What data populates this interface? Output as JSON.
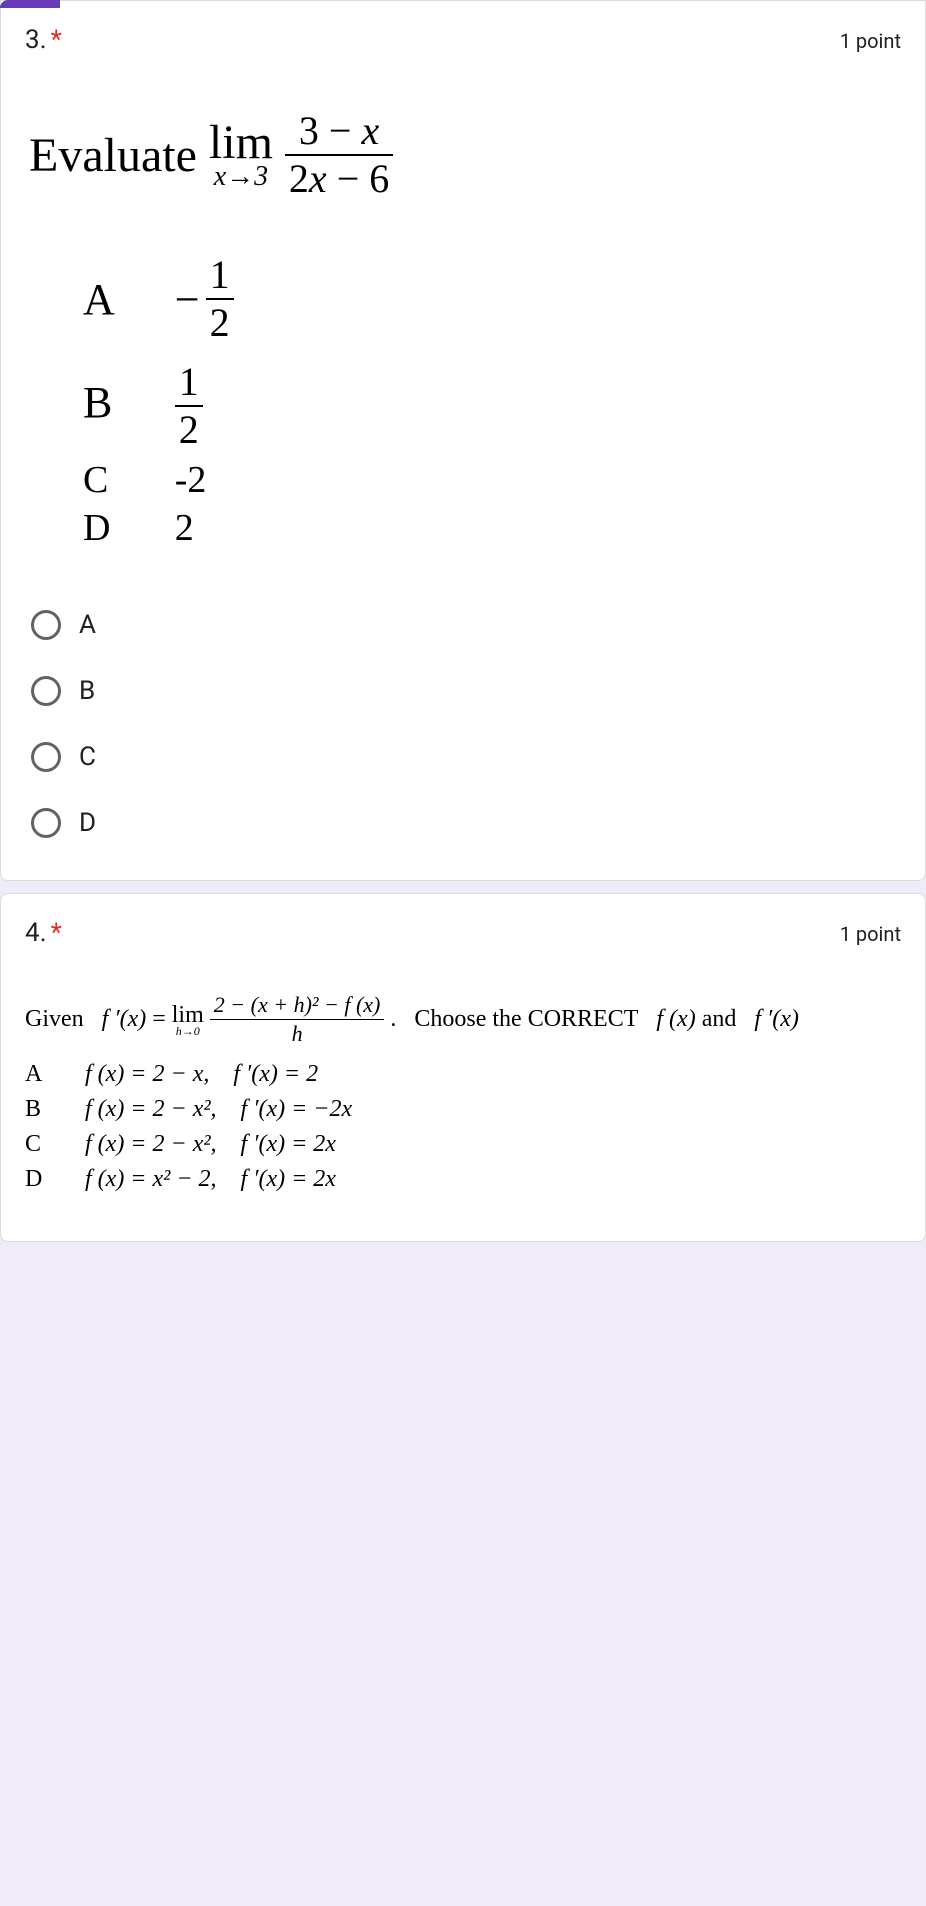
{
  "q3": {
    "number": "3.",
    "required": "*",
    "points": "1 point",
    "stem_lead": "Evaluate",
    "limit_word": "lim",
    "limit_sub": "x→3",
    "frac_top_a": "3",
    "frac_top_op": "−",
    "frac_top_b": "x",
    "frac_bot_a": "2",
    "frac_bot_b": "x",
    "frac_bot_op": "−",
    "frac_bot_c": "6",
    "answers": {
      "A": {
        "letter": "A",
        "minus": "−",
        "num": "1",
        "den": "2"
      },
      "B": {
        "letter": "B",
        "num": "1",
        "den": "2"
      },
      "C": {
        "letter": "C",
        "val": "-2"
      },
      "D": {
        "letter": "D",
        "val": "2"
      }
    },
    "options": [
      "A",
      "B",
      "C",
      "D"
    ]
  },
  "q4": {
    "number": "4.",
    "required": "*",
    "points": "1 point",
    "given": "Given",
    "fprime": "f ′(x)",
    "eq": "=",
    "limit_word": "lim",
    "limit_sub": "h→0",
    "frac_top": "2 − (x + h)² − f (x)",
    "frac_bot": "h",
    "period": ".",
    "choose": "Choose the CORRECT",
    "fx": "f (x)",
    "and": "and",
    "fpx": "f ′(x)",
    "answers": {
      "A": {
        "letter": "A",
        "fx": "f (x) = 2 − x,",
        "fpx": "f ′(x) = 2"
      },
      "B": {
        "letter": "B",
        "fx": "f (x) = 2 − x²,",
        "fpx": "f ′(x) = −2x"
      },
      "C": {
        "letter": "C",
        "fx": "f (x) = 2 − x²,",
        "fpx": "f ′(x) = 2x"
      },
      "D": {
        "letter": "D",
        "fx": "f (x) = x² − 2,",
        "fpx": "f ′(x) = 2x"
      }
    }
  }
}
